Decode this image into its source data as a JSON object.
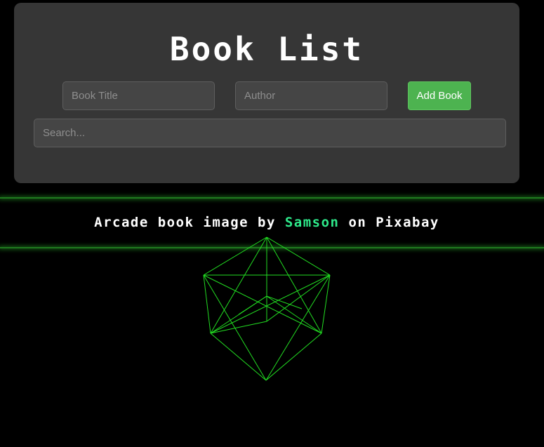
{
  "header": {
    "title": "Book List"
  },
  "form": {
    "title_placeholder": "Book Title",
    "author_placeholder": "Author",
    "add_button_label": "Add Book",
    "search_placeholder": "Search..."
  },
  "credit": {
    "prefix": "Arcade book image by ",
    "author_link": "Samson",
    "suffix": " on Pixabay"
  },
  "colors": {
    "background": "#000000",
    "panel": "#363636",
    "accent_green": "#4db350",
    "wireframe": "#22dd22",
    "link": "#2ee88a"
  }
}
